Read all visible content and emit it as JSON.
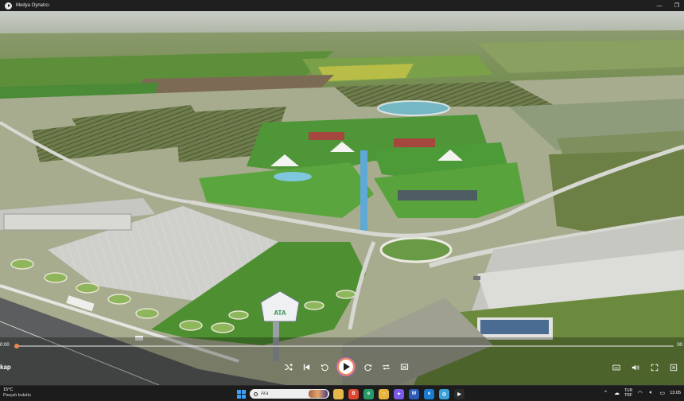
{
  "window": {
    "title": "Medya Oynatıcı",
    "minimize_glyph": "—",
    "restore_glyph": "❐"
  },
  "player": {
    "elapsed": "0:00",
    "total": "00",
    "progress": 0.0,
    "video_title": "kap",
    "accent_color": "#e8884f"
  },
  "controls": {
    "left": [
      "shuffle-icon",
      "previous-icon",
      "rewind-icon"
    ],
    "center": "play-icon",
    "right_of_play": [
      "forward-icon",
      "repeat-icon",
      "cast-icon"
    ],
    "far_right": [
      "subtitles-icon",
      "volume-icon",
      "fullscreen-icon",
      "more-icon"
    ]
  },
  "billboard": {
    "brand": "ATA"
  },
  "taskbar": {
    "weather_temp": "15°C",
    "weather_desc": "Parçalı bulutlu",
    "search_placeholder": "Ara",
    "lang_line1": "TUR",
    "lang_line2": "TRF",
    "clock": "13.05",
    "apps": [
      {
        "name": "file-explorer-icon",
        "color": "#e6b84a",
        "glyph": ""
      },
      {
        "name": "brave-icon",
        "color": "#e0462e",
        "glyph": "B"
      },
      {
        "name": "edge-icon",
        "color": "#2b9a6b",
        "glyph": "e"
      },
      {
        "name": "chrome-icon",
        "color": "#e8b33c",
        "glyph": "○"
      },
      {
        "name": "copilot-icon",
        "color": "#7a5be8",
        "glyph": "✦"
      },
      {
        "name": "word-icon",
        "color": "#2a5bb7",
        "glyph": "W"
      },
      {
        "name": "edge-dev-icon",
        "color": "#1b7bd1",
        "glyph": "e"
      },
      {
        "name": "browser-icon",
        "color": "#3aa0d8",
        "glyph": "◎"
      },
      {
        "name": "media-player-icon",
        "color": "#2c2c2c",
        "glyph": "▶"
      }
    ]
  }
}
